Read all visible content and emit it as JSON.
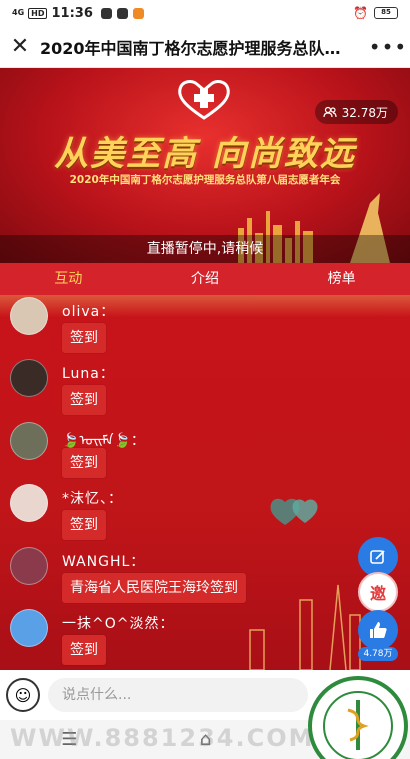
{
  "status_bar": {
    "signal": "4G",
    "hd": "HD",
    "time": "11:36",
    "battery": "85"
  },
  "title_bar": {
    "close_icon": "close-icon",
    "title": "2020年中国南丁格尔志愿护理服务总队…",
    "more_icon": "more-icon"
  },
  "banner": {
    "viewers": "32.78万",
    "slogan": "从美至高 向尚致远",
    "subtitle": "2020年中国南丁格尔志愿护理服务总队第八届志愿者年会",
    "status": "直播暂停中,请稍候"
  },
  "tabs": [
    {
      "label": "互动",
      "active": true
    },
    {
      "label": "介绍",
      "active": false
    },
    {
      "label": "榜单",
      "active": false
    }
  ],
  "messages": [
    {
      "name": "oliva：",
      "text": "签到",
      "avatar_color": "#d9c7b3"
    },
    {
      "name": "Luna：",
      "text": "签到",
      "avatar_color": "#3a2b26"
    },
    {
      "name": "🍃ᠣᠢᠮᠠ🍃：",
      "text": "签到",
      "avatar_color": "#6d6f5a"
    },
    {
      "name": "*沫忆、：",
      "text": "签到",
      "avatar_color": "#e9d6cf"
    },
    {
      "name": "WANGHL：",
      "text": "青海省人民医院王海玲签到",
      "avatar_color": "#8a3a4a"
    },
    {
      "name": "一抹^O^淡然：",
      "text": "签到",
      "avatar_color": "#5aa0e6"
    }
  ],
  "side": {
    "invite": "邀",
    "like_count": "4.78万"
  },
  "input": {
    "placeholder": "说点什么..."
  },
  "watermark": "WWW.8881234.COM",
  "colors": {
    "primary_red": "#d4232b",
    "active_tab": "#ffd35a",
    "action_blue": "#2b7be4"
  }
}
